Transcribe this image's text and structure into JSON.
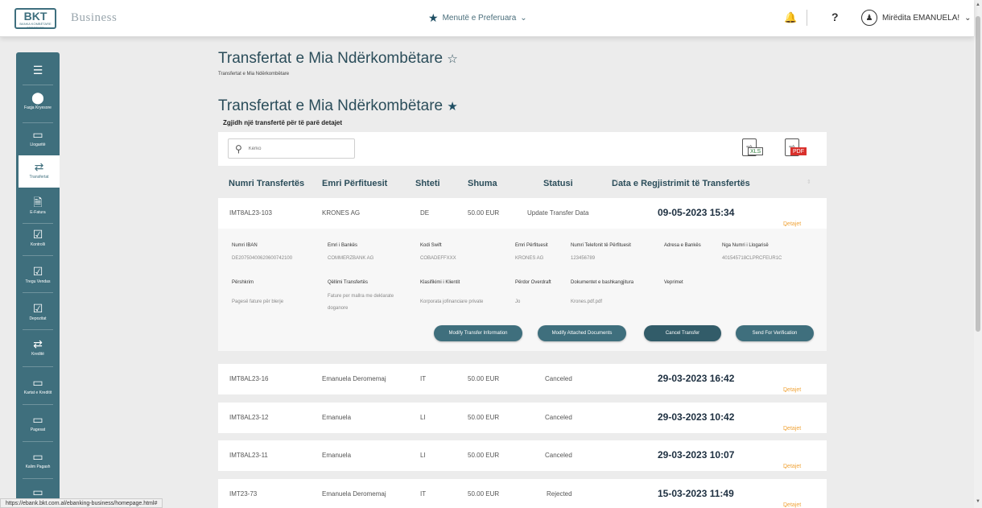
{
  "header": {
    "logo_text": "BKT",
    "logo_subtext": "BANKA KOMBËTARE TREGTARE",
    "brand": "Business",
    "favorites_menu": "Menutë e Preferuara",
    "help": "?",
    "user_greeting": "Mirëdita EMANUELA!"
  },
  "sidebar": {
    "items": [
      {
        "icon": "menu",
        "label": ""
      },
      {
        "icon": "home",
        "label": "Faqja Kryesore"
      },
      {
        "icon": "accounts",
        "label": "Llogaritë"
      },
      {
        "icon": "transfers",
        "label": "Transfertat"
      },
      {
        "icon": "e-invoice",
        "label": "E-Fatura"
      },
      {
        "icon": "control",
        "label": "Kontrolli"
      },
      {
        "icon": "currency-market",
        "label": "Tregu Vendas"
      },
      {
        "icon": "deposits",
        "label": "Depozitat"
      },
      {
        "icon": "loans",
        "label": "Kreditë"
      },
      {
        "icon": "cards",
        "label": "Kartat e Kreditit"
      },
      {
        "icon": "payments",
        "label": "Pagesat"
      },
      {
        "icon": "salary",
        "label": "Kalim Pagash"
      },
      {
        "icon": "more",
        "label": ""
      }
    ]
  },
  "page": {
    "title": "Transfertat e Mia Ndërkombëtare",
    "breadcrumb": "Transfertat e Mia Ndërkombëtare",
    "section_title": "Transfertat e Mia Ndërkombëtare",
    "subtitle": "Zgjidh një transfertë për të parë detajet"
  },
  "search": {
    "placeholder": "Kërko"
  },
  "exports": {
    "xls": "XLS",
    "pdf": "PDF"
  },
  "table": {
    "headers": [
      "Numri Transfertës",
      "Emri Përfituesit",
      "Shteti",
      "Shuma",
      "Statusi",
      "Data e Regjistrimit të Transfertës"
    ],
    "details_label": "Detajet",
    "rows": [
      {
        "id": "IMT8AL23-103",
        "beneficiary": "KRONES AG",
        "country": "DE",
        "amount": "50.00 EUR",
        "status": "Update Transfer Data",
        "date": "09-05-2023 15:34"
      },
      {
        "id": "IMT8AL23-16",
        "beneficiary": "Emanuela Deromemaj",
        "country": "IT",
        "amount": "50.00 EUR",
        "status": "Canceled",
        "date": "29-03-2023 16:42"
      },
      {
        "id": "IMT8AL23-12",
        "beneficiary": "Emanuela",
        "country": "LI",
        "amount": "50.00 EUR",
        "status": "Canceled",
        "date": "29-03-2023 10:42"
      },
      {
        "id": "IMT8AL23-11",
        "beneficiary": "Emanuela",
        "country": "LI",
        "amount": "50.00 EUR",
        "status": "Canceled",
        "date": "29-03-2023 10:07"
      },
      {
        "id": "IMT23-73",
        "beneficiary": "Emanuela Deromemaj",
        "country": "IT",
        "amount": "50.00 EUR",
        "status": "Rejected",
        "date": "15-03-2023 11:49"
      }
    ]
  },
  "detail": {
    "labels": {
      "iban": "Numri IBAN",
      "bank_name": "Emri i Bankës",
      "swift": "Kodi Swift",
      "beneficiary": "Emri Përfituesit",
      "phone": "Numri Telefonit të Përfituesit",
      "bank_address": "Adresa e Bankës",
      "from_account": "Nga Numri i Llogarisë",
      "description": "Përshkrim",
      "purpose": "Qëllimi Transfertës",
      "client_class": "Klasifikimi i Klientit",
      "overdraft": "Përdor Overdraft",
      "attachments": "Dokumentet e bashkangjitura",
      "actions": "Veprimet"
    },
    "values": {
      "iban": "DE20750400620600742100",
      "bank_name": "COMMERZBANK AG",
      "swift": "COBADEFFXXX",
      "beneficiary": "KRONES AG",
      "phone": "123456789",
      "bank_address": "",
      "from_account": "401545718CLPRCFEUR1C",
      "description": "Pagesë fature për blerje",
      "purpose_line1": "Fature per mallra me deklarate",
      "purpose_line2": "doganore",
      "client_class": "Korporata jofinanciare private",
      "overdraft": "Jo",
      "attachments": "Krones.pdf.pdf"
    },
    "buttons": {
      "modify_info": "Modify Transfer Information",
      "modify_docs": "Modify Attached Documents",
      "cancel": "Cancel Transfer",
      "verify": "Send For Verification"
    }
  },
  "status_url": "https://ebank.bkt.com.al/ebanking-business/homepage.html#"
}
